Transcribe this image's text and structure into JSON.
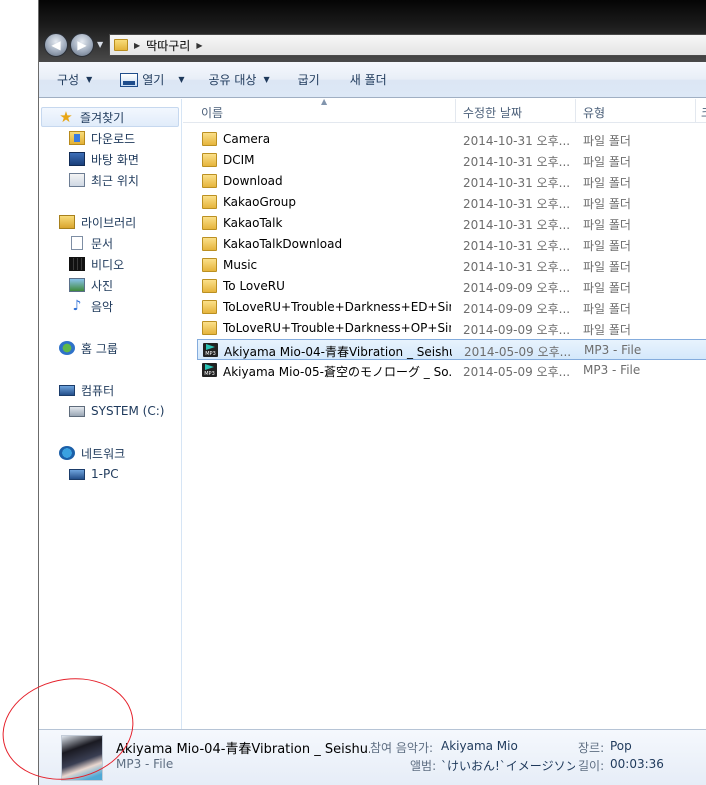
{
  "address": {
    "crumbs": [
      "딱따구리"
    ]
  },
  "toolbar": {
    "organize": "구성",
    "open": "열기",
    "share": "공유 대상",
    "burn": "굽기",
    "new_folder": "새 폴더"
  },
  "nav": {
    "favorites": "즐겨찾기",
    "downloads": "다운로드",
    "desktop": "바탕 화면",
    "recent": "최근 위치",
    "libraries": "라이브러리",
    "documents": "문서",
    "videos": "비디오",
    "pictures": "사진",
    "music": "음악",
    "homegroup": "홈 그룹",
    "computer": "컴퓨터",
    "drive": "SYSTEM (C:)",
    "network": "네트워크",
    "network_pc": "1-PC"
  },
  "columns": {
    "name": "이름",
    "date": "수정한 날짜",
    "type": "유형",
    "size": "크"
  },
  "files": [
    {
      "name": "Camera",
      "date": "2014-10-31 오후...",
      "type": "파일 폴더",
      "icon": "folder-icon"
    },
    {
      "name": "DCIM",
      "date": "2014-10-31 오후...",
      "type": "파일 폴더",
      "icon": "folder-icon"
    },
    {
      "name": "Download",
      "date": "2014-10-31 오후...",
      "type": "파일 폴더",
      "icon": "folder-icon"
    },
    {
      "name": "KakaoGroup",
      "date": "2014-10-31 오후...",
      "type": "파일 폴더",
      "icon": "folder-icon"
    },
    {
      "name": "KakaoTalk",
      "date": "2014-10-31 오후...",
      "type": "파일 폴더",
      "icon": "folder-icon"
    },
    {
      "name": "KakaoTalkDownload",
      "date": "2014-10-31 오후...",
      "type": "파일 폴더",
      "icon": "folder-icon"
    },
    {
      "name": "Music",
      "date": "2014-10-31 오후...",
      "type": "파일 폴더",
      "icon": "folder-icon"
    },
    {
      "name": "To LoveRU",
      "date": "2014-09-09 오후...",
      "type": "파일 폴더",
      "icon": "folder-icon"
    },
    {
      "name": "ToLoveRU+Trouble+Darkness+ED+Singl...",
      "date": "2014-09-09 오후...",
      "type": "파일 폴더",
      "icon": "folder-icon"
    },
    {
      "name": "ToLoveRU+Trouble+Darkness+OP+Singl...",
      "date": "2014-09-09 오후...",
      "type": "파일 폴더",
      "icon": "folder-icon"
    },
    {
      "name": "Akiyama Mio-04-青春Vibration _ Seishu...",
      "date": "2014-05-09 오후...",
      "type": "MP3 - File",
      "icon": "mp3-file-icon",
      "selected": true
    },
    {
      "name": "Akiyama Mio-05-蒼空のモノローグ _ So...",
      "date": "2014-05-09 오후...",
      "type": "MP3 - File",
      "icon": "mp3-file-icon"
    }
  ],
  "details": {
    "title": "Akiyama Mio-04-青春Vibration _ Seishu...",
    "type": "MP3 - File",
    "artist_label": "참여 음악가:",
    "artist": "Akiyama Mio",
    "album_label": "앨범:",
    "album": "`けいおん!`イメージソン...",
    "genre_label": "장르:",
    "genre": "Pop",
    "length_label": "길이:",
    "length": "00:03:36"
  },
  "colors": {
    "selection": "#d4e8fb",
    "annotation": "#e5212b"
  }
}
